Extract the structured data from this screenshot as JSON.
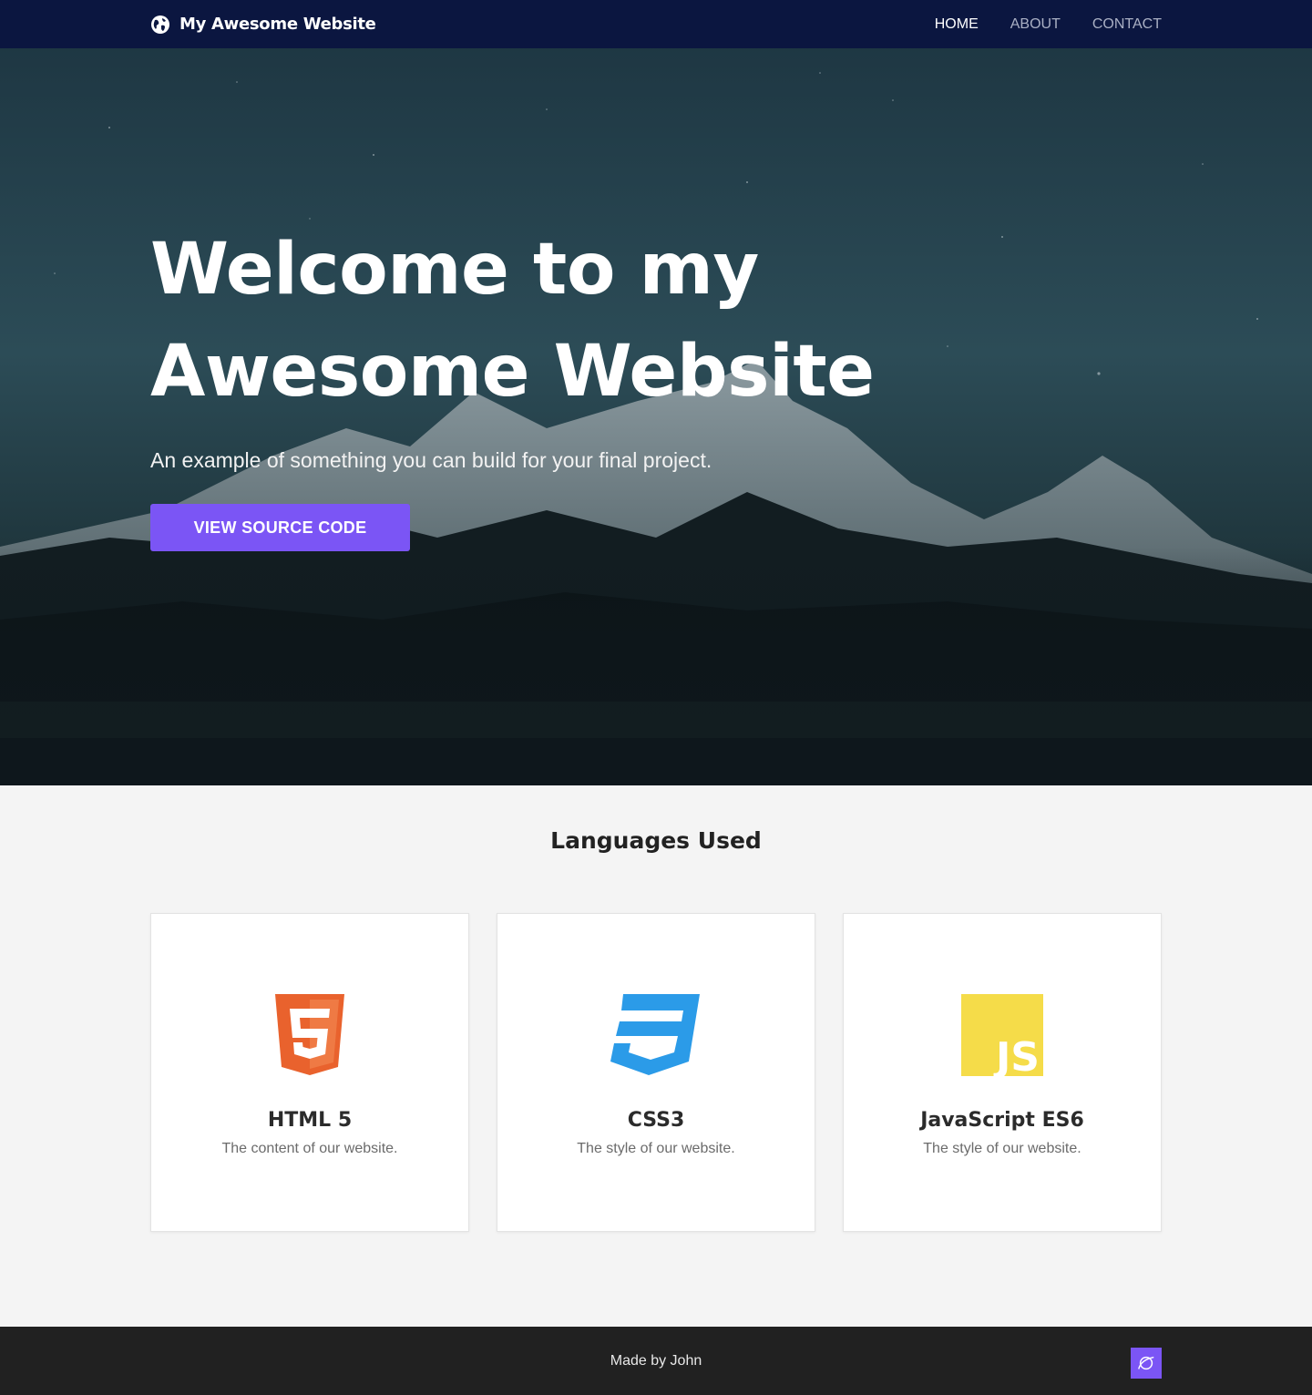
{
  "navbar": {
    "brand": "My Awesome Website",
    "brand_icon": "globe-icon",
    "links": [
      {
        "label": "HOME",
        "active": true
      },
      {
        "label": "ABOUT",
        "active": false
      },
      {
        "label": "CONTACT",
        "active": false
      }
    ]
  },
  "hero": {
    "title_line1": "Welcome to my",
    "title_line2": "Awesome Website",
    "subtitle": "An example of something you can build for your final project.",
    "button_label": "VIEW SOURCE CODE"
  },
  "languages": {
    "title": "Languages Used",
    "cards": [
      {
        "icon": "html5-icon",
        "title": "HTML 5",
        "description": "The content of our website."
      },
      {
        "icon": "css3-icon",
        "title": "CSS3",
        "description": "The style of our website."
      },
      {
        "icon": "javascript-icon",
        "title": "JavaScript ES6",
        "description": "The style of our website.",
        "icon_text": "JS"
      }
    ]
  },
  "footer": {
    "text": "Made by John",
    "badge_icon": "planet-icon"
  },
  "colors": {
    "navbar_bg": "#0b1640",
    "accent": "#7b55f5",
    "footer_bg": "#212121",
    "html5": "#e9622d",
    "css3": "#2b9be8",
    "js": "#f5dc49"
  }
}
